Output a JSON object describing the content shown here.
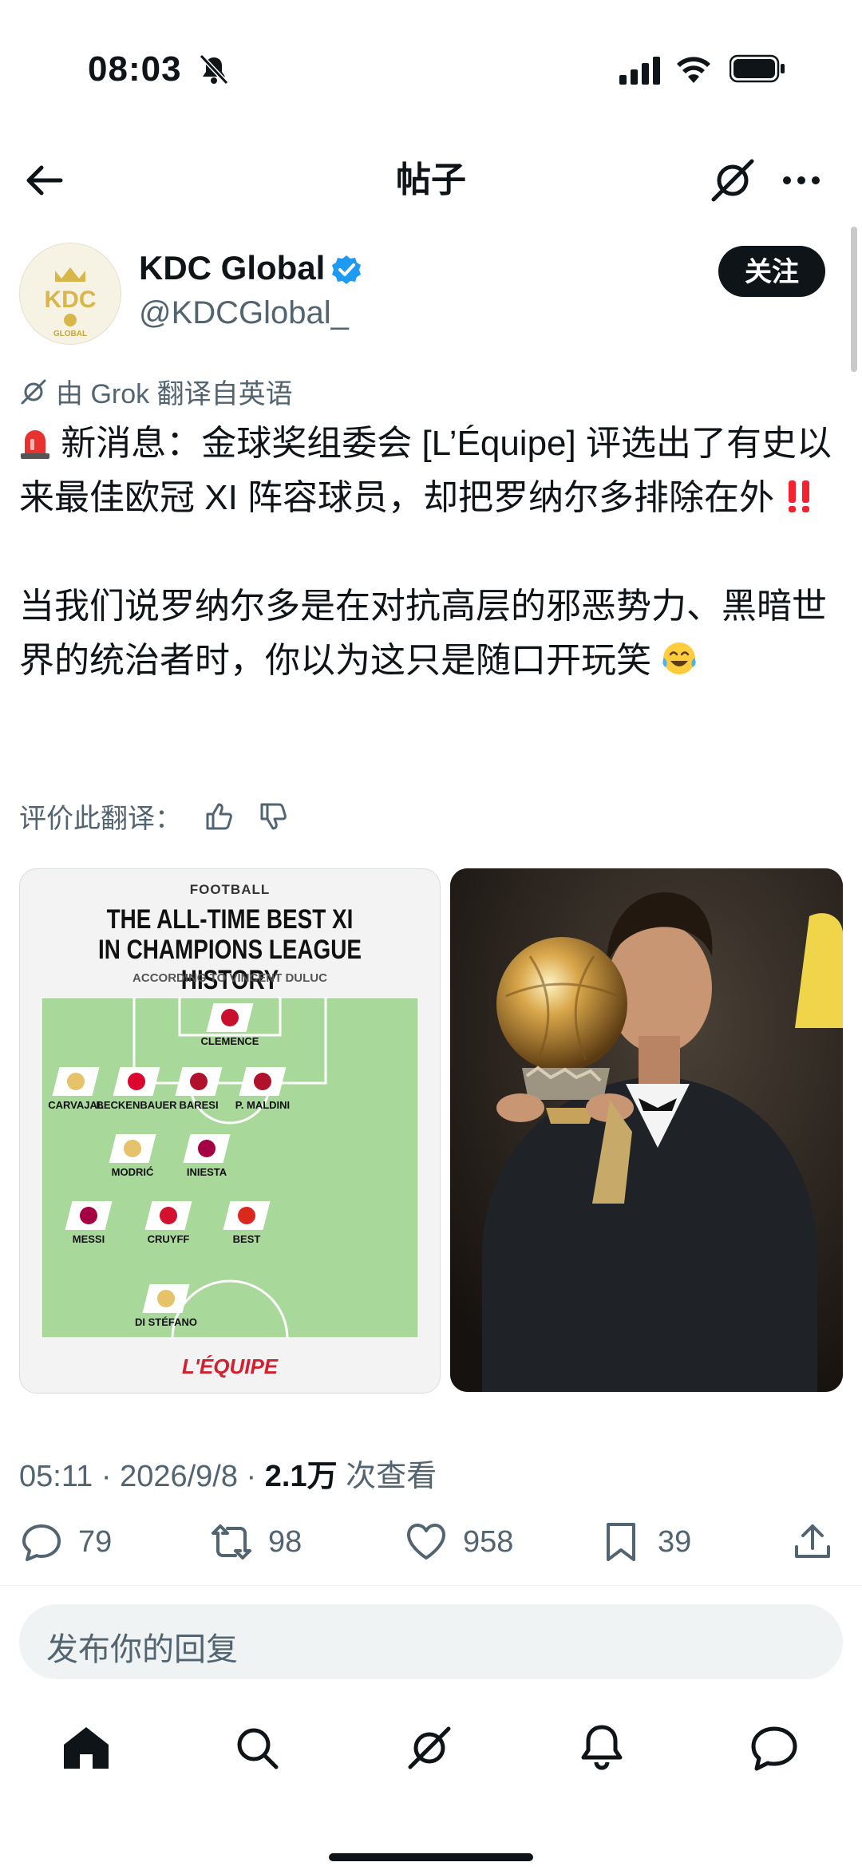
{
  "status_bar": {
    "time": "08:03"
  },
  "header": {
    "title": "帖子"
  },
  "author": {
    "name": "KDC Global",
    "handle": "@KDCGlobal_",
    "avatar_text": "KDC",
    "avatar_sub": "GLOBAL",
    "follow_label": "关注"
  },
  "translation": {
    "note": "由 Grok 翻译自英语",
    "rate_label": "评价此翻译："
  },
  "tweet": {
    "line1": "新消息：金球奖组委会 [L’Équipe] 评选出了有史以来最佳欧冠 XI 阵容球员，却把罗纳尔多排除在外",
    "line2": "当我们说罗纳尔多是在对抗高层的邪恶势力、黑暗世界的统治者时，你以为这只是随口开玩笑"
  },
  "infographic": {
    "kicker": "FOOTBALL",
    "title_1": "THE ALL-TIME BEST XI",
    "title_2": "IN CHAMPIONS LEAGUE HISTORY",
    "subtitle": "ACCORDING TO VINCENT DULUC",
    "brand": "L'ÉQUIPE",
    "players": [
      {
        "name": "CLEMENCE",
        "color": "#c8102e"
      },
      {
        "name": "CARVAJAL",
        "color": "#e6c26a"
      },
      {
        "name": "BECKENBAUER",
        "color": "#dc052d"
      },
      {
        "name": "BARESI",
        "color": "#b0122b"
      },
      {
        "name": "P. MALDINI",
        "color": "#b0122b"
      },
      {
        "name": "MODRIĆ",
        "color": "#e6c26a"
      },
      {
        "name": "INIESTA",
        "color": "#a50044"
      },
      {
        "name": "MESSI",
        "color": "#a50044"
      },
      {
        "name": "CRUYFF",
        "color": "#d2122e"
      },
      {
        "name": "BEST",
        "color": "#da291c"
      },
      {
        "name": "DI STÉFANO",
        "color": "#e6c26a"
      }
    ]
  },
  "meta": {
    "time": "05:11",
    "date": "2026/9/8",
    "views": "2.1万",
    "views_label": "次查看"
  },
  "actions": {
    "replies": "79",
    "reposts": "98",
    "likes": "958",
    "bookmarks": "39"
  },
  "reply_box": {
    "placeholder": "发布你的回复"
  },
  "colors": {
    "accent": "#1d9bf0",
    "text": "#0f1419",
    "muted": "#536471",
    "alert": "#f4212e"
  }
}
